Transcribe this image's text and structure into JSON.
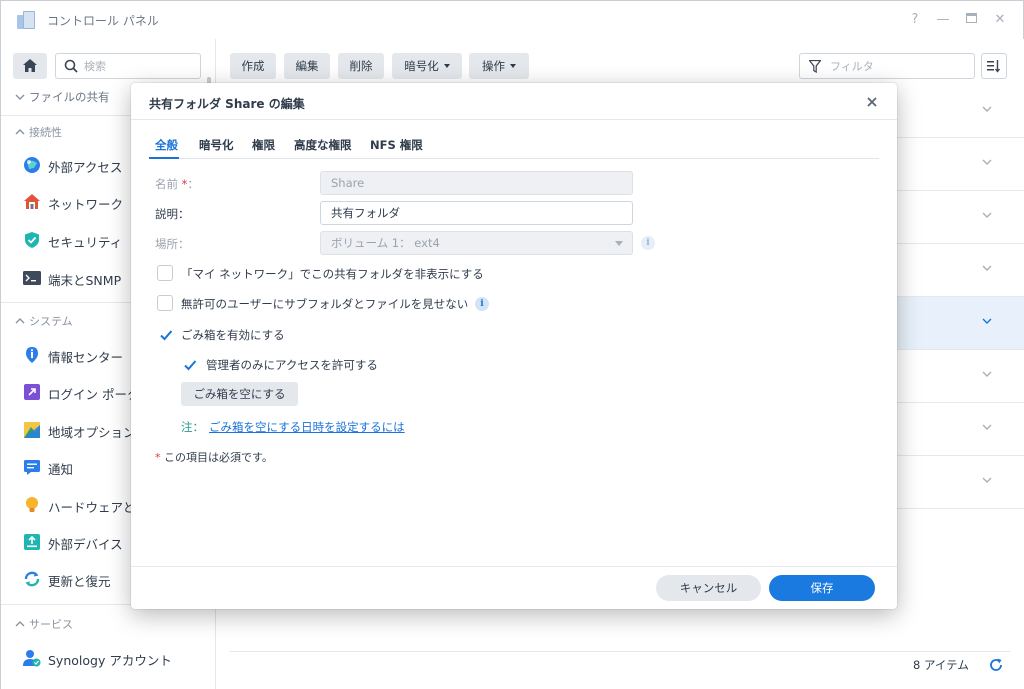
{
  "window": {
    "title": "コントロール パネル",
    "controls": [
      "?",
      "—",
      "□",
      "✕"
    ]
  },
  "sidebar": {
    "search_placeholder": "検索",
    "truncated_item": "ファイルの共有",
    "sections": [
      {
        "header": "接続性",
        "items": [
          {
            "label": "外部アクセス",
            "icon": "globe-icon"
          },
          {
            "label": "ネットワーク",
            "icon": "home-network-icon"
          },
          {
            "label": "セキュリティ",
            "icon": "shield-check-icon"
          },
          {
            "label": "端末とSNMP",
            "icon": "terminal-icon"
          }
        ]
      },
      {
        "header": "システム",
        "items": [
          {
            "label": "情報センター",
            "icon": "info-pin-icon"
          },
          {
            "label": "ログイン ポータル",
            "icon": "login-portal-icon"
          },
          {
            "label": "地域オプション",
            "icon": "region-icon"
          },
          {
            "label": "通知",
            "icon": "notification-icon"
          },
          {
            "label": "ハードウェアと電源",
            "icon": "bulb-icon"
          },
          {
            "label": "外部デバイス",
            "icon": "external-device-icon"
          },
          {
            "label": "更新と復元",
            "icon": "update-icon"
          }
        ]
      },
      {
        "header": "サービス",
        "items": [
          {
            "label": "Synology アカウント",
            "icon": "account-icon"
          }
        ]
      }
    ]
  },
  "toolbar": {
    "create": "作成",
    "edit": "編集",
    "delete": "削除",
    "encrypt": "暗号化",
    "action": "操作",
    "filter_placeholder": "フィルタ"
  },
  "list": {
    "selected_row": 4,
    "count_label": "8 アイテム"
  },
  "dialog": {
    "title": "共有フォルダ Share の編集",
    "tabs": [
      "全般",
      "暗号化",
      "権限",
      "高度な権限",
      "NFS 権限"
    ],
    "active_tab": 0,
    "fields": {
      "name_label": "名前",
      "name_required": "*",
      "name_suffix": "：",
      "name_value": "Share",
      "desc_label": "説明：",
      "desc_value": "共有フォルダ",
      "location_label": "場所：",
      "location_value": "ボリューム 1： ext4"
    },
    "options": {
      "hide_network": "「マイ ネットワーク」でこの共有フォルダを非表示にする",
      "hide_unauth": "無許可のユーザーにサブフォルダとファイルを見せない",
      "recycle_bin": "ごみ箱を有効にする",
      "admin_only": "管理者のみにアクセスを許可する"
    },
    "option_states": {
      "hide_network": false,
      "hide_unauth": false,
      "recycle_bin": true,
      "admin_only": true
    },
    "empty_bin_button": "ごみ箱を空にする",
    "note_label": "注：",
    "note_link": "ごみ箱を空にする日時を設定するには",
    "required_star": "*",
    "required_note": "この項目は必須です。",
    "cancel": "キャンセル",
    "save": "保存"
  },
  "colors": {
    "accent": "#1a73d9",
    "save_button": "#1a7ae0",
    "required": "#e5373d",
    "note": "#2b9b8f",
    "selected_row": "#e8f1fb"
  }
}
